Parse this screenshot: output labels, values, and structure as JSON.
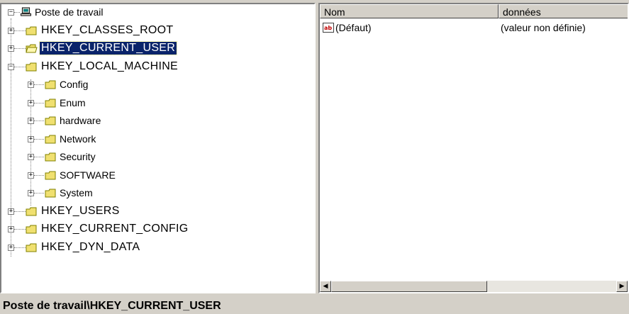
{
  "tree": {
    "root": {
      "label": "Poste de travail"
    },
    "keys": [
      {
        "label": "HKEY_CLASSES_ROOT"
      },
      {
        "label": "HKEY_CURRENT_USER"
      },
      {
        "label": "HKEY_LOCAL_MACHINE"
      },
      {
        "label": "HKEY_USERS"
      },
      {
        "label": "HKEY_CURRENT_CONFIG"
      },
      {
        "label": "HKEY_DYN_DATA"
      }
    ],
    "local_machine_children": [
      {
        "label": "Config"
      },
      {
        "label": "Enum"
      },
      {
        "label": "hardware"
      },
      {
        "label": "Network"
      },
      {
        "label": "Security"
      },
      {
        "label": "SOFTWARE"
      },
      {
        "label": "System"
      }
    ],
    "selected": "HKEY_CURRENT_USER"
  },
  "list": {
    "columns": {
      "name": "Nom",
      "data": "données"
    },
    "rows": [
      {
        "name": "(Défaut)",
        "data": "(valeur non définie)",
        "icon": "string-value-icon"
      }
    ]
  },
  "status": {
    "path": "Poste de travail\\HKEY_CURRENT_USER"
  },
  "colors": {
    "selection": "#0a246a",
    "folder": "#f0e070",
    "chrome": "#d4d0c8"
  }
}
